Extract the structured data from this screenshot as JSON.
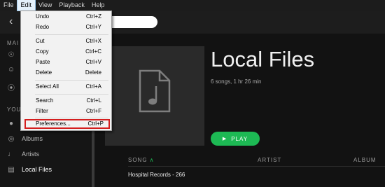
{
  "menubar": [
    "File",
    "Edit",
    "View",
    "Playback",
    "Help"
  ],
  "sidebar": {
    "main_heading": "MAI",
    "your_heading": "YOU",
    "items": [
      {
        "icon": "compass-icon",
        "label": ""
      },
      {
        "icon": "user-icon",
        "label": ""
      },
      {
        "icon": "radio-icon",
        "label": ""
      },
      {
        "icon": "info-icon",
        "label": ""
      },
      {
        "icon": "album-icon",
        "label": "Albums"
      },
      {
        "icon": "mic-icon",
        "label": "Artists"
      },
      {
        "icon": "file-icon",
        "label": "Local Files"
      }
    ]
  },
  "main": {
    "title": "Local Files",
    "subtitle": "6 songs, 1 hr 26 min",
    "play_label": "PLAY",
    "columns": {
      "song": "SONG",
      "artist": "ARTIST",
      "album": "ALBUM"
    },
    "tracks": [
      "Hospital Records - 266"
    ]
  },
  "edit_menu": {
    "items": [
      {
        "label": "Undo",
        "shortcut": "Ctrl+Z"
      },
      {
        "label": "Redo",
        "shortcut": "Ctrl+Y"
      },
      {
        "label": "Cut",
        "shortcut": "Ctrl+X"
      },
      {
        "label": "Copy",
        "shortcut": "Ctrl+C"
      },
      {
        "label": "Paste",
        "shortcut": "Ctrl+V"
      },
      {
        "label": "Delete",
        "shortcut": "Delete"
      },
      {
        "label": "Select All",
        "shortcut": "Ctrl+A"
      },
      {
        "label": "Search",
        "shortcut": "Ctrl+L"
      },
      {
        "label": "Filter",
        "shortcut": "Ctrl+F"
      },
      {
        "label": "Preferences...",
        "shortcut": "Ctrl+P"
      }
    ]
  },
  "colors": {
    "accent": "#1db954",
    "highlight_border": "#d41e1e"
  }
}
